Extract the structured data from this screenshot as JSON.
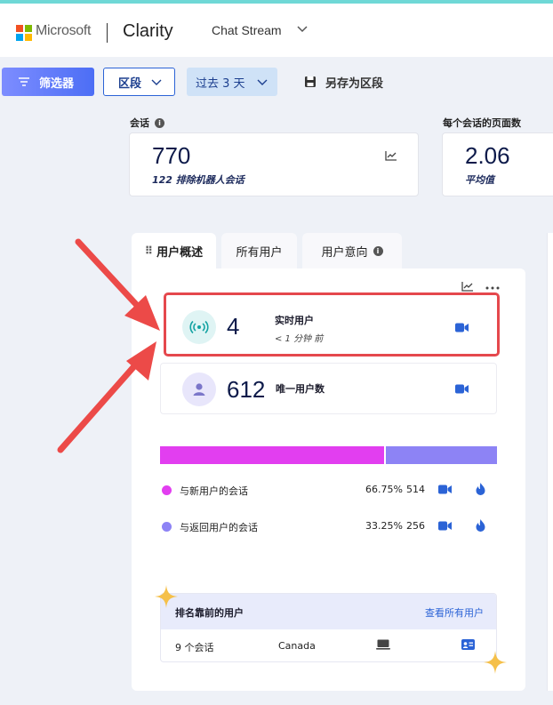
{
  "header": {
    "brand": "Microsoft",
    "product": "Clarity",
    "project": "Chat Stream"
  },
  "toolbar": {
    "filter_label": "筛选器",
    "segment_label": "区段",
    "date_label": "过去 3 天",
    "save_label": "另存为区段"
  },
  "metrics": {
    "sessions": {
      "label": "会话",
      "value": "770",
      "sub": "122 排除机器人会话"
    },
    "pages_per_session": {
      "label": "每个会话的页面数",
      "value": "2.06",
      "sub": "平均值"
    }
  },
  "tabs": [
    {
      "label": "用户概述"
    },
    {
      "label": "所有用户"
    },
    {
      "label": "用户意向"
    }
  ],
  "live_users": {
    "value": "4",
    "title": "实时用户",
    "sub": "< 1 分钟 前"
  },
  "unique_users": {
    "value": "612",
    "title": "唯一用户数"
  },
  "split": {
    "new_fraction": 0.6675,
    "returning_fraction": 0.3325,
    "new_color": "#e23ef0",
    "returning_color": "#8d83f5"
  },
  "legend": [
    {
      "label": "与新用户的会话",
      "pct": "66.75%",
      "count": "514",
      "color": "#e23ef0"
    },
    {
      "label": "与返回用户的会话",
      "pct": "33.25%",
      "count": "256",
      "color": "#8d83f5"
    }
  ],
  "top_users": {
    "title": "排名靠前的用户",
    "link": "查看所有用户",
    "row": {
      "sessions": "9 个会话",
      "country": "Canada"
    }
  }
}
